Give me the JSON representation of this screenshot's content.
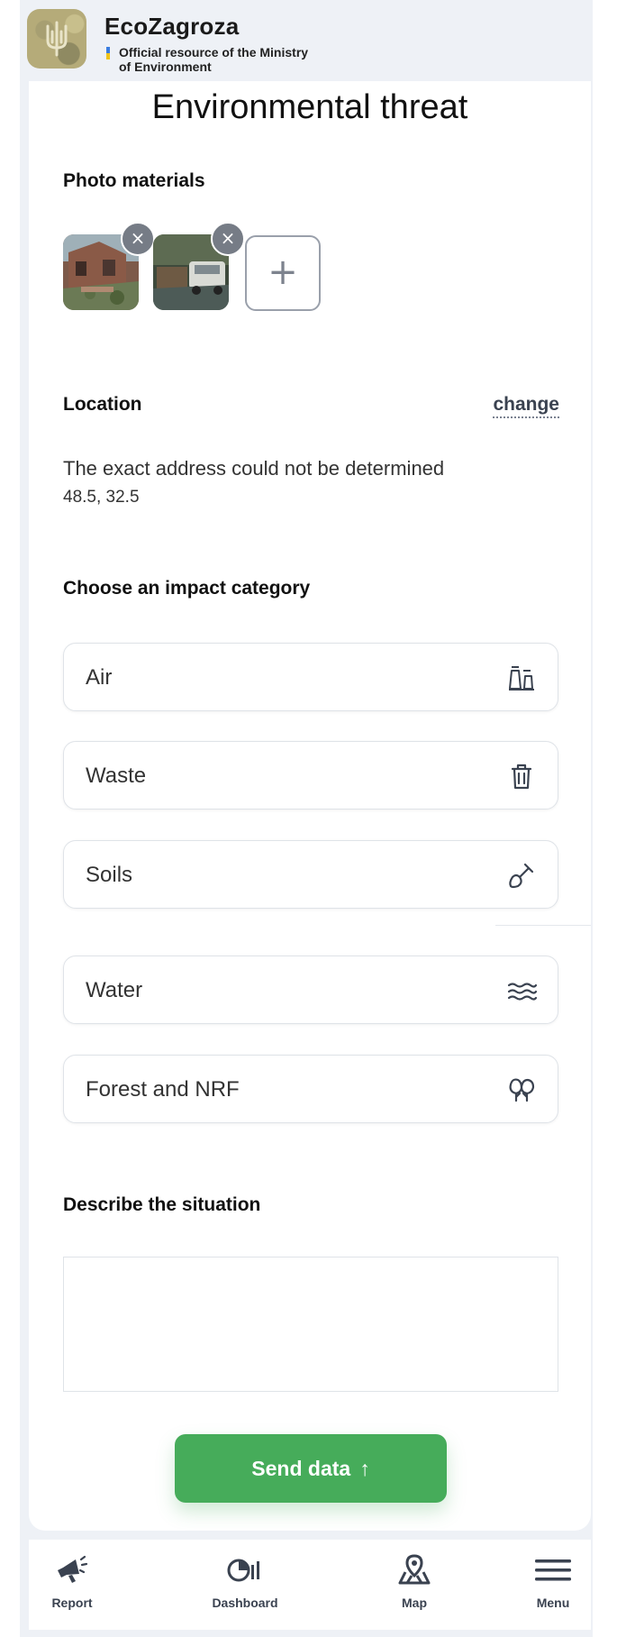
{
  "header": {
    "app_name": "EcoZagroza",
    "subtitle_line1": "Official resource of the Ministry",
    "subtitle_line2": "of Environment"
  },
  "page": {
    "title": "Environmental threat"
  },
  "photos": {
    "label": "Photo materials",
    "remove_glyph": "×",
    "add_glyph": "+"
  },
  "location": {
    "label": "Location",
    "change_label": "change",
    "address": "The exact address could not be determined",
    "coords": "48.5, 32.5"
  },
  "category": {
    "label": "Choose an impact category",
    "items": [
      {
        "label": "Air",
        "icon": "air-icon"
      },
      {
        "label": "Waste",
        "icon": "trash-icon"
      },
      {
        "label": "Soils",
        "icon": "shovel-icon"
      },
      {
        "label": "Water",
        "icon": "water-waves-icon"
      },
      {
        "label": "Forest and NRF",
        "icon": "trees-icon"
      }
    ]
  },
  "describe": {
    "label": "Describe the situation",
    "value": ""
  },
  "send": {
    "label": "Send data",
    "arrow": "↑"
  },
  "nav": {
    "items": [
      {
        "label": "Report",
        "icon": "megaphone-icon"
      },
      {
        "label": "Dashboard",
        "icon": "dashboard-chart-icon"
      },
      {
        "label": "Map",
        "icon": "map-pin-icon"
      },
      {
        "label": "Menu",
        "icon": "hamburger-menu-icon"
      }
    ]
  },
  "colors": {
    "accent_green": "#46ac5a",
    "icon_dark": "#3a4250",
    "flag_blue": "#3b7de0",
    "flag_yellow": "#f0c419"
  }
}
